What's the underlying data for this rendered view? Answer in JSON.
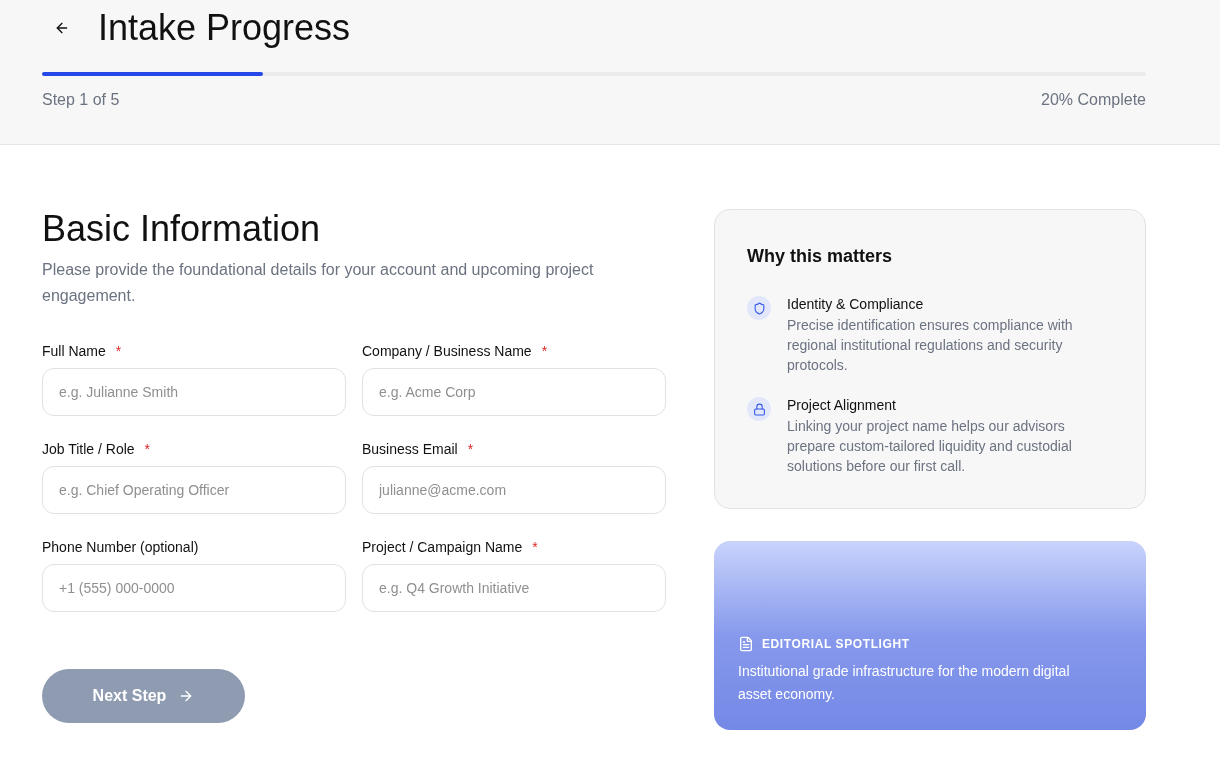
{
  "header": {
    "title": "Intake Progress",
    "progress": {
      "level": 0.2
    },
    "step_label": "Step 1 of 5",
    "percent_label": "20% Complete"
  },
  "form": {
    "title": "Basic Information",
    "description": "Please provide the foundational details for your account and upcoming project engagement.",
    "fields": [
      {
        "label": "Full Name",
        "required_mark": "*",
        "placeholder": "e.g. Julianne Smith"
      },
      {
        "label": "Company / Business Name",
        "required_mark": "*",
        "placeholder": "e.g. Acme Corp"
      },
      {
        "label": "Job Title / Role",
        "required_mark": "*",
        "placeholder": "e.g. Chief Operating Officer"
      },
      {
        "label": "Business Email",
        "required_mark": "*",
        "placeholder": "julianne@acme.com"
      },
      {
        "label": "Phone Number (optional)",
        "placeholder": "+1 (555) 000-0000"
      },
      {
        "label": "Project / Campaign Name",
        "required_mark": "*",
        "placeholder": "e.g. Q4 Growth Initiative"
      }
    ],
    "next_button": {
      "label": "Next Step",
      "disabled": true
    }
  },
  "info_card": {
    "title": "Why this matters",
    "items": [
      {
        "title": "Identity & Compliance",
        "description": "Precise identification ensures compliance with regional institutional regulations and security protocols."
      },
      {
        "title": "Project Alignment",
        "description": "Linking your project name helps our advisors prepare custom-tailored liquidity and custodial solutions before our first call."
      }
    ]
  },
  "spotlight": {
    "eyebrow": "EDITORIAL SPOTLIGHT",
    "text": "Institutional grade infrastructure for the modern digital asset economy."
  }
}
